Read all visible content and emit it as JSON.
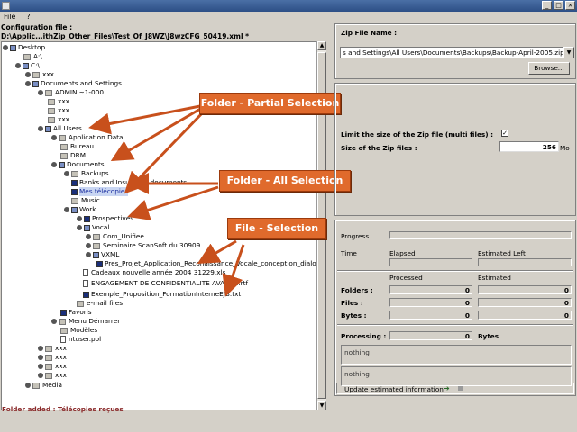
{
  "window": {
    "title": "",
    "min": "_",
    "max": "□",
    "close": "×"
  },
  "menu": {
    "file": "File",
    "help": "?"
  },
  "config": {
    "label": "Configuration file :",
    "path": "D:\\Applic...ithZip_Other_Files\\Test_Of_J8WZ\\J8wzCFG_50419.xml *"
  },
  "tree": [
    {
      "label": "Desktop"
    },
    {
      "label": "A:\\"
    },
    {
      "label": "C:\\"
    },
    {
      "label": "xxx"
    },
    {
      "label": "Documents and Settings"
    },
    {
      "label": "ADMINI~1-000"
    },
    {
      "label": "xxx"
    },
    {
      "label": "xxx"
    },
    {
      "label": "xxx"
    },
    {
      "label": "All Users"
    },
    {
      "label": "Application Data"
    },
    {
      "label": "Bureau"
    },
    {
      "label": "DRM"
    },
    {
      "label": "Documents"
    },
    {
      "label": "Backups"
    },
    {
      "label": "Banks and Insurance documents"
    },
    {
      "label": "Mes télécopies"
    },
    {
      "label": "Music"
    },
    {
      "label": "Work"
    },
    {
      "label": "Prospectives"
    },
    {
      "label": "Vocal"
    },
    {
      "label": "Com_Unifiee"
    },
    {
      "label": "Seminaire ScanSoft du 30909"
    },
    {
      "label": "VXML"
    },
    {
      "label": "Pres_Projet_Application_Reconaissance_Vocale_conception_dialogue"
    },
    {
      "label": "Cadeaux nouvelle année 2004 31229.xls"
    },
    {
      "label": "ENGAGEMENT DE CONFIDENTIALITE AVANCE.rtf"
    },
    {
      "label": "Exemple_Proposition_FormationInterneEJB.txt"
    },
    {
      "label": "e-mail files"
    },
    {
      "label": "Favoris"
    },
    {
      "label": "Menu Démarrer"
    },
    {
      "label": "Modèles"
    },
    {
      "label": "ntuser.pol"
    },
    {
      "label": "xxx"
    },
    {
      "label": "xxx"
    },
    {
      "label": "xxx"
    },
    {
      "label": "xxx"
    },
    {
      "label": "Media"
    }
  ],
  "callouts": {
    "partial": "Folder - Partial Selection",
    "all": "Folder - All Selection",
    "file": "File - Selection"
  },
  "zip": {
    "label": "Zip File Name :",
    "value": "s and Settings\\All Users\\Documents\\Backups\\Backup-April-2005.zip",
    "browse": "Browse..."
  },
  "limit": {
    "label": "Limit the size of the Zip file (multi files) :",
    "checked": true,
    "size_label": "Size of the Zip files :",
    "size_value": "256",
    "unit": "Mo"
  },
  "progress": {
    "progress_label": "Progress",
    "time_label": "Time",
    "elapsed_label": "Elapsed",
    "estimated_left_label": "Estimated Left",
    "processed_header": "Processed",
    "estimated_header": "Estimated",
    "rows": [
      {
        "label": "Folders :",
        "processed": "0",
        "estimated": "0"
      },
      {
        "label": "Files :",
        "processed": "0",
        "estimated": "0"
      },
      {
        "label": "Bytes :",
        "processed": "0",
        "estimated": "0"
      }
    ],
    "processing_label": "Processing :",
    "processing_value": "0",
    "bytes_label": "Bytes",
    "nothing1": "nothing",
    "nothing2": "nothing",
    "update_label": "Update estimated information"
  },
  "status": {
    "message": "Folder added : Télécopies reçues"
  }
}
